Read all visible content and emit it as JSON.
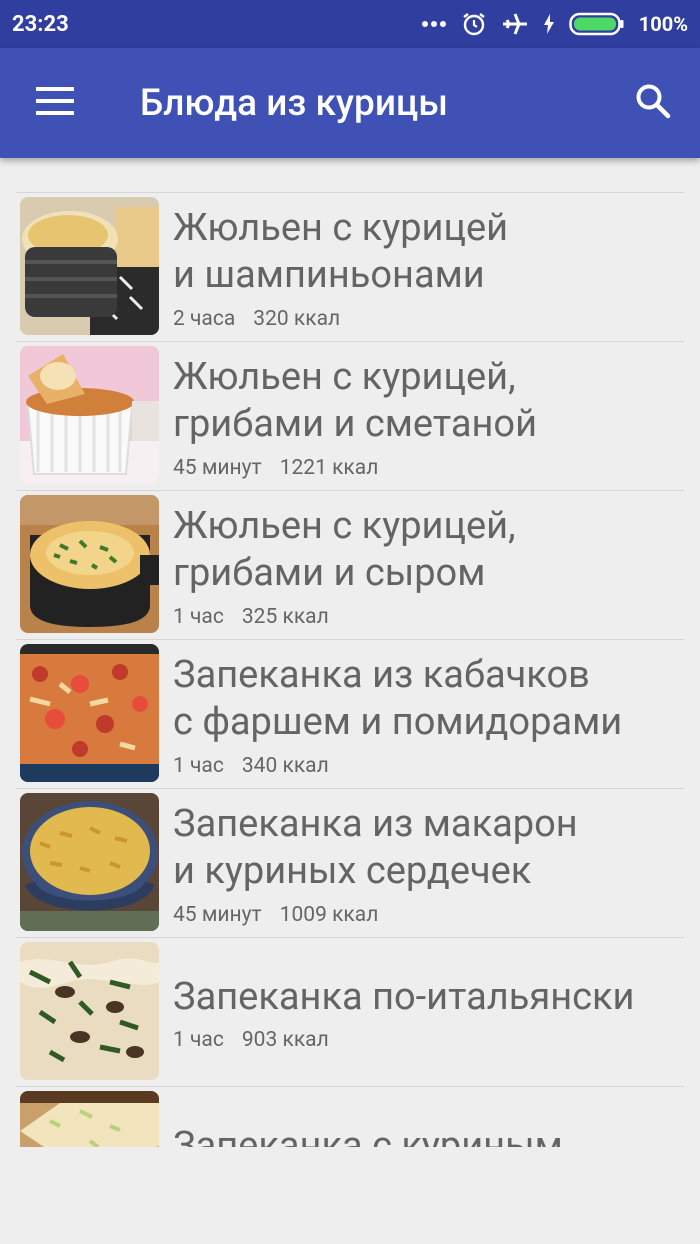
{
  "status_bar": {
    "time": "23:23",
    "battery": "100%",
    "icons": [
      "more-dots-icon",
      "alarm-icon",
      "airplane-icon",
      "charging-icon",
      "battery-icon"
    ]
  },
  "toolbar": {
    "title": "Блюда из курицы",
    "menu_icon": "hamburger-menu-icon",
    "search_icon": "search-icon",
    "color": "#3f51b5",
    "status_color": "#303f9f"
  },
  "recipes": [
    {
      "title": "Жюльен с курицей\nи шампиньонами",
      "time": "2 часа",
      "kcal": "320 ккал"
    },
    {
      "title": "Жюльен с курицей,\nгрибами и сметаной",
      "time": "45 минут",
      "kcal": "1221 ккал"
    },
    {
      "title": "Жюльен с курицей,\nгрибами и сыром",
      "time": "1 час",
      "kcal": "325 ккал"
    },
    {
      "title": "Запеканка из кабачков\nс фаршем и помидорами",
      "time": "1 час",
      "kcal": "340 ккал"
    },
    {
      "title": "Запеканка из макарон\nи куриных сердечек",
      "time": "45 минут",
      "kcal": "1009 ккал"
    },
    {
      "title": "Запеканка по-итальянски",
      "time": "1 час",
      "kcal": "903 ккал"
    },
    {
      "title": "Запеканка с куриным",
      "time": "",
      "kcal": ""
    }
  ]
}
